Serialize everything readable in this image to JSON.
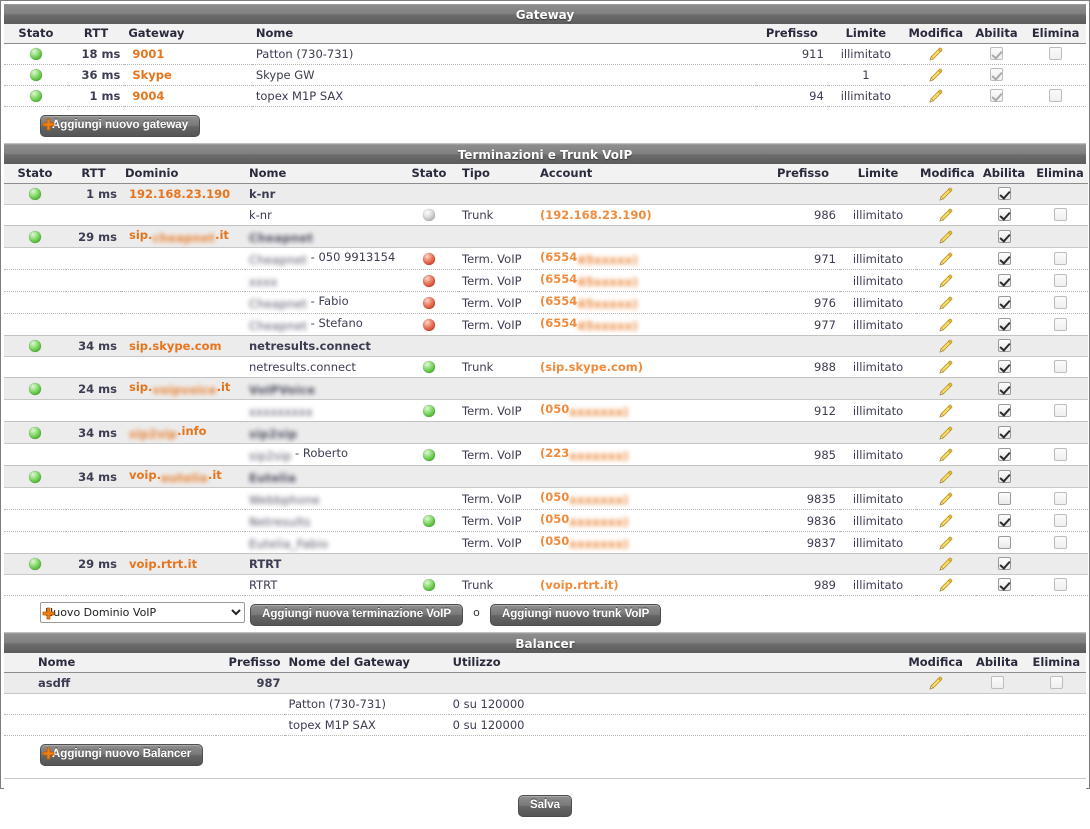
{
  "sections": {
    "gateway": {
      "title": "Gateway",
      "columns": [
        "Stato",
        "RTT",
        "Gateway",
        "Nome",
        "Prefisso",
        "Limite",
        "Modifica",
        "Abilita",
        "Elimina"
      ],
      "rows": [
        {
          "stato": "green",
          "rtt": "18 ms",
          "gateway": "9001",
          "nome": "Patton (730-731)",
          "prefisso": "911",
          "limite": "illimitato",
          "abilita": true,
          "elimina": false,
          "has_elimina": true
        },
        {
          "stato": "green",
          "rtt": "36 ms",
          "gateway": "Skype",
          "nome": "Skype GW",
          "prefisso": "",
          "limite": "1",
          "abilita": true,
          "elimina": false,
          "has_elimina": false
        },
        {
          "stato": "green",
          "rtt": "1 ms",
          "gateway": "9004",
          "nome": "topex M1P SAX",
          "prefisso": "94",
          "limite": "illimitato",
          "abilita": true,
          "elimina": false,
          "has_elimina": true
        }
      ],
      "add_button": "Aggiungi nuovo gateway"
    },
    "terminazioni": {
      "title": "Terminazioni e Trunk VoIP",
      "columns": [
        "Stato",
        "RTT",
        "Dominio",
        "Nome",
        "Stato",
        "Tipo",
        "Account",
        "Prefisso",
        "Limite",
        "Modifica",
        "Abilita",
        "Elimina"
      ],
      "domains": [
        {
          "stato": "green",
          "rtt": "1 ms",
          "dominio": "192.168.23.190",
          "dominio_blur": false,
          "nome": "k-nr",
          "nome_blur": false,
          "abilita": true,
          "children": [
            {
              "nome": "k-nr",
              "nome_blur": false,
              "stato": "grey",
              "tipo": "Trunk",
              "account": "(192.168.23.190)",
              "account_blur": false,
              "prefisso": "986",
              "limite": "illimitato",
              "abilita": true,
              "elimina": false
            }
          ]
        },
        {
          "stato": "green",
          "rtt": "29 ms",
          "dominio": "sip.cheapnet.it",
          "dominio_blur": true,
          "dominio_prefix": "sip.",
          "dominio_blur_text": "cheapnet",
          "dominio_suffix": ".it",
          "nome": "Cheapnet",
          "nome_blur": true,
          "abilita": true,
          "children": [
            {
              "nome": "Cheapnet - 050 9913154",
              "nome_blur": true,
              "nome_plain_part": " - 050 ",
              "stato": "red",
              "tipo": "Term. VoIP",
              "account": "(655445xxxxx)",
              "account_blur": true,
              "account_prefix": "(6554",
              "prefisso": "971",
              "limite": "illimitato",
              "abilita": true,
              "elimina": false
            },
            {
              "nome": "xxxx",
              "nome_blur": true,
              "stato": "red",
              "tipo": "Term. VoIP",
              "account": "(655445xxxxx)",
              "account_blur": true,
              "account_prefix": "(6554",
              "prefisso": "",
              "limite": "illimitato",
              "abilita": true,
              "elimina": false
            },
            {
              "nome": "Cheapnet - Fabio",
              "nome_blur": true,
              "nome_plain_part": " - Fabio",
              "stato": "red",
              "tipo": "Term. VoIP",
              "account": "(655445xxxxx)",
              "account_blur": true,
              "account_prefix": "(6554",
              "prefisso": "976",
              "limite": "illimitato",
              "abilita": true,
              "elimina": false
            },
            {
              "nome": "Cheapnet - Stefano",
              "nome_blur": true,
              "nome_plain_part": " - Stefano",
              "stato": "red",
              "tipo": "Term. VoIP",
              "account": "(655445xxxxx)",
              "account_blur": true,
              "account_prefix": "(6554",
              "prefisso": "977",
              "limite": "illimitato",
              "abilita": true,
              "elimina": false
            }
          ]
        },
        {
          "stato": "green",
          "rtt": "34 ms",
          "dominio": "sip.skype.com",
          "dominio_blur": false,
          "nome": "netresults.connect",
          "nome_blur": false,
          "abilita": true,
          "children": [
            {
              "nome": "netresults.connect",
              "nome_blur": false,
              "stato": "green",
              "tipo": "Trunk",
              "account": "(sip.skype.com)",
              "account_blur": false,
              "prefisso": "988",
              "limite": "illimitato",
              "abilita": true,
              "elimina": false
            }
          ]
        },
        {
          "stato": "green",
          "rtt": "24 ms",
          "dominio": "sip.voipvoice.it",
          "dominio_blur": true,
          "dominio_prefix": "sip.",
          "dominio_blur_text": "voipvoice",
          "dominio_suffix": ".it",
          "nome": "VoIPVoice",
          "nome_blur": true,
          "abilita": true,
          "children": [
            {
              "nome": "xxxxxxxxx",
              "nome_blur": true,
              "stato": "green",
              "tipo": "Term. VoIP",
              "account": "(050xxxxxxx)",
              "account_blur": true,
              "account_prefix": "(050",
              "prefisso": "912",
              "limite": "illimitato",
              "abilita": true,
              "elimina": false
            }
          ]
        },
        {
          "stato": "green",
          "rtt": "34 ms",
          "dominio": "sip2sip.info",
          "dominio_blur": true,
          "dominio_prefix": "",
          "dominio_blur_text": "sip2sip",
          "dominio_suffix": ".info",
          "nome": "sip2sip",
          "nome_blur": true,
          "abilita": true,
          "children": [
            {
              "nome": "sip2sip - Roberto",
              "nome_blur": true,
              "nome_plain_part": " - Roberto",
              "stato": "green",
              "tipo": "Term. VoIP",
              "account": "(223xxxxxxx)",
              "account_blur": true,
              "account_prefix": "(223",
              "prefisso": "985",
              "limite": "illimitato",
              "abilita": true,
              "elimina": false
            }
          ]
        },
        {
          "stato": "green",
          "rtt": "34 ms",
          "dominio": "voip.eutelia.it",
          "dominio_blur": true,
          "dominio_prefix": "voip.",
          "dominio_blur_text": "eutelia",
          "dominio_suffix": ".it",
          "nome": "Eutelia",
          "nome_blur": true,
          "abilita": true,
          "children": [
            {
              "nome": "Webbphone",
              "nome_blur": true,
              "stato": "none",
              "tipo": "Term. VoIP",
              "account": "(050xxxxxxx)",
              "account_blur": true,
              "account_prefix": "(050",
              "prefisso": "9835",
              "limite": "illimitato",
              "abilita": false,
              "elimina": false
            },
            {
              "nome": "Netresults",
              "nome_blur": true,
              "stato": "green",
              "tipo": "Term. VoIP",
              "account": "(050xxxxxxx)",
              "account_blur": true,
              "account_prefix": "(050",
              "prefisso": "9836",
              "limite": "illimitato",
              "abilita": true,
              "elimina": false
            },
            {
              "nome": "Eutelia_Fabio",
              "nome_blur": true,
              "stato": "none",
              "tipo": "Term. VoIP",
              "account": "(050xxxxxxx)",
              "account_blur": true,
              "account_prefix": "(050",
              "prefisso": "9837",
              "limite": "illimitato",
              "abilita": false,
              "elimina": false
            }
          ]
        },
        {
          "stato": "green",
          "rtt": "29 ms",
          "dominio": "voip.rtrt.it",
          "dominio_blur": false,
          "nome": "RTRT",
          "nome_blur": false,
          "abilita": true,
          "children": [
            {
              "nome": "RTRT",
              "nome_blur": false,
              "stato": "green",
              "tipo": "Trunk",
              "account": "(voip.rtrt.it)",
              "account_blur": false,
              "prefisso": "989",
              "limite": "illimitato",
              "abilita": true,
              "elimina": false
            }
          ]
        }
      ],
      "toolbar": {
        "select_value": "Nuovo Dominio VoIP",
        "add_termination_button": "Aggiungi nuova terminazione VoIP",
        "or_label": "o",
        "add_trunk_button": "Aggiungi nuovo trunk VoIP"
      }
    },
    "balancer": {
      "title": "Balancer",
      "columns": [
        "Nome",
        "Prefisso",
        "Nome del Gateway",
        "Utilizzo",
        "Modifica",
        "Abilita",
        "Elimina"
      ],
      "rows": [
        {
          "nome": "asdff",
          "prefisso": "987",
          "gateway": "",
          "utilizzo": "",
          "abilita": false,
          "elimina": false,
          "is_head": true
        }
      ],
      "children": [
        {
          "gateway": "Patton (730-731)",
          "utilizzo": "0 su 120000"
        },
        {
          "gateway": "topex M1P SAX",
          "utilizzo": "0 su 120000"
        }
      ],
      "add_button": "Aggiungi nuovo Balancer"
    }
  },
  "footer": {
    "save_button": "Salva"
  },
  "colors": {
    "accent_orange": "#e8741c",
    "header_grey": "#6c6c6c",
    "row_head_bg": "#ececec"
  }
}
